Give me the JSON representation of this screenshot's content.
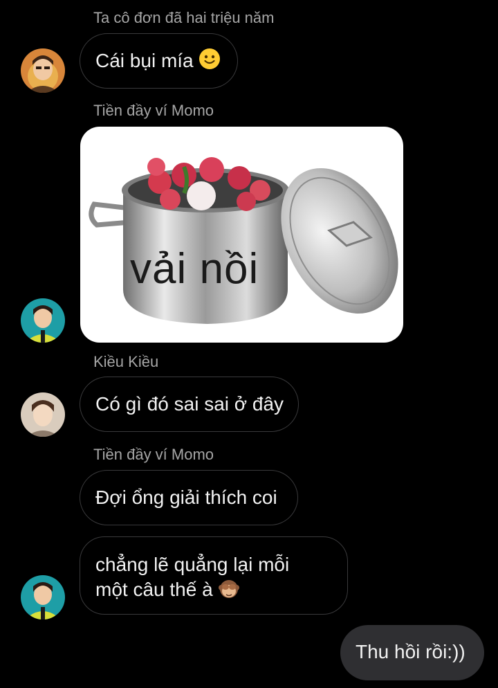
{
  "messages": [
    {
      "sender": "Ta cô đơn đã hai triệu năm",
      "text": "Cái bụi mía",
      "emoji": "slightly-smiling-face-icon"
    },
    {
      "sender": "Tiền đầy ví Momo",
      "image_caption": "vải nồi"
    },
    {
      "sender": "Kiều Kiều",
      "text": "Có gì đó sai sai ở đây"
    },
    {
      "sender": "Tiền đầy ví Momo",
      "text": "Đợi ổng giải thích coi"
    },
    {
      "text_line1": "chẳng lẽ quẳng lại mỗi",
      "text_line2": "một câu thế à",
      "emoji": "see-no-evil-monkey-icon"
    },
    {
      "outgoing": true,
      "text": "Thu hồi rồi:))"
    }
  ],
  "colors": {
    "background": "#000000",
    "incoming_bubble_border": "#3a3a3c",
    "outgoing_bubble": "#2f2f32",
    "sender_name": "#a6a6a6",
    "text": "#f2f2f2"
  }
}
